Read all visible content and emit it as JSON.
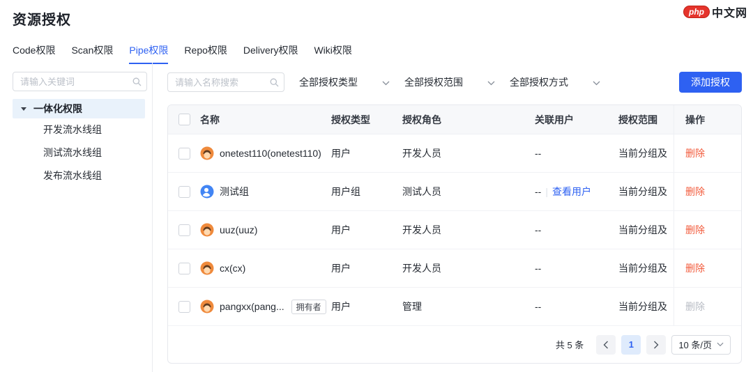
{
  "brand": {
    "logo_badge": "php",
    "logo_text": "中文网"
  },
  "page": {
    "title": "资源授权"
  },
  "tabs": {
    "items": [
      "Code权限",
      "Scan权限",
      "Pipe权限",
      "Repo权限",
      "Delivery权限",
      "Wiki权限"
    ],
    "active": "Pipe权限"
  },
  "sidebar": {
    "search_placeholder": "请输入关键词",
    "tree_root": "一体化权限",
    "tree_children": [
      "开发流水线组",
      "测试流水线组",
      "发布流水线组"
    ]
  },
  "toolbar": {
    "search_placeholder": "请输入名称搜索",
    "filter_type": "全部授权类型",
    "filter_scope": "全部授权范围",
    "filter_method": "全部授权方式",
    "add_button": "添加授权"
  },
  "table": {
    "columns": {
      "name": "名称",
      "auth_type": "授权类型",
      "auth_role": "授权角色",
      "related_users": "关联用户",
      "auth_scope": "授权范围",
      "actions": "操作"
    },
    "rows": [
      {
        "name": "onetest110(onetest110)",
        "avatar": "user",
        "auth_type": "用户",
        "auth_role": "开发人员",
        "related_users": "--",
        "auth_scope": "当前分组及",
        "action": "删除"
      },
      {
        "name": "测试组",
        "avatar": "group",
        "auth_type": "用户组",
        "auth_role": "测试人员",
        "related_users": "--",
        "users_divider": "|",
        "view_users_link": "查看用户",
        "auth_scope": "当前分组及",
        "action": "删除"
      },
      {
        "name": "uuz(uuz)",
        "avatar": "user",
        "auth_type": "用户",
        "auth_role": "开发人员",
        "related_users": "--",
        "auth_scope": "当前分组及",
        "action": "删除"
      },
      {
        "name": "cx(cx)",
        "avatar": "user",
        "auth_type": "用户",
        "auth_role": "开发人员",
        "related_users": "--",
        "auth_scope": "当前分组及",
        "action": "删除"
      },
      {
        "name": "pangxx(pang...",
        "avatar": "user",
        "badge": "拥有者",
        "auth_type": "用户",
        "auth_role": "管理",
        "related_users": "--",
        "auth_scope": "当前分组及",
        "action": "删除",
        "action_disabled": true
      }
    ]
  },
  "pagination": {
    "total": "共 5 条",
    "current_page": "1",
    "page_size": "10 条/页"
  },
  "colors": {
    "accent": "#2e61f2",
    "danger": "#f25b3c",
    "selected_bg": "#e9f2fb",
    "header_bg": "#f7f8fa"
  }
}
